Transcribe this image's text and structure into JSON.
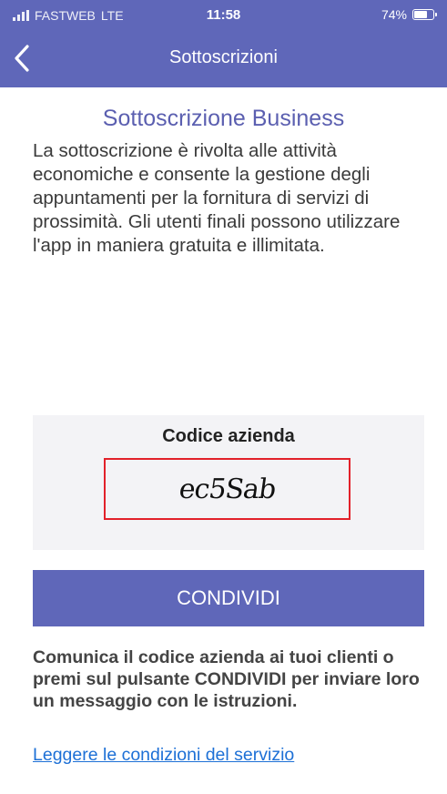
{
  "status_bar": {
    "carrier": "FASTWEB",
    "network": "LTE",
    "time": "11:58",
    "battery_percent": "74%",
    "battery_level": 0.74
  },
  "navbar": {
    "back_icon": "chevron-left-icon",
    "title": "Sottoscrizioni"
  },
  "content": {
    "heading": "Sottoscrizione Business",
    "description": "La sottoscrizione è rivolta alle attività economiche e consente la gestione degli appuntamenti per la fornitura di servizi di prossimità. Gli utenti finali possono utilizzare l'app in maniera gratuita e illimitata.",
    "code_label": "Codice azienda",
    "code_value": "ec5Sab",
    "share_button": "CONDIVIDI",
    "share_note": "Comunica il codice azienda ai tuoi clienti o premi sul pulsante CONDIVIDI per inviare loro un messaggio con le istruzioni.",
    "terms_link": "Leggere le condizioni del servizio"
  },
  "colors": {
    "primary": "#5f67b9",
    "heading": "#5b5fb0",
    "highlight_border": "#e2212a",
    "link": "#1d70d6"
  }
}
